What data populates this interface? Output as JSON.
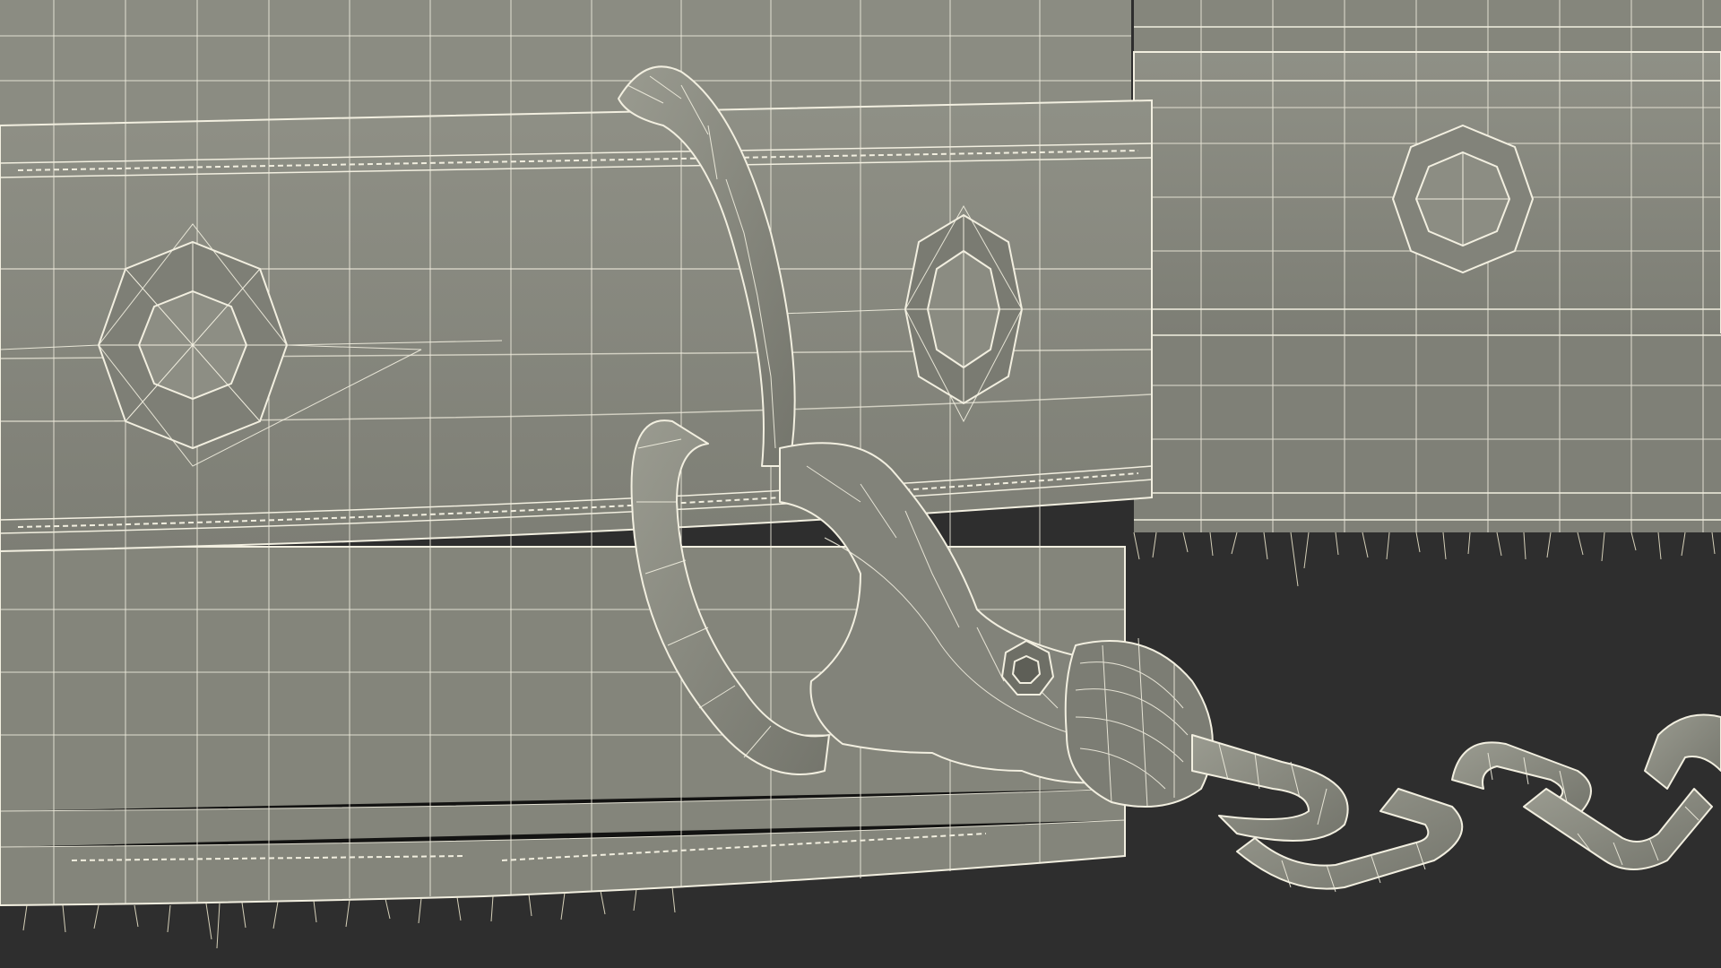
{
  "scene": {
    "subject": "wireframe-render-shackles-with-chain",
    "colors": {
      "background": "#2e2e2e",
      "surface": "#8a8b80",
      "surface_shadow": "#6e6f66",
      "surface_highlight": "#9a9b90",
      "wire": "#f2efe0",
      "fur": "#e8e2c8"
    }
  }
}
